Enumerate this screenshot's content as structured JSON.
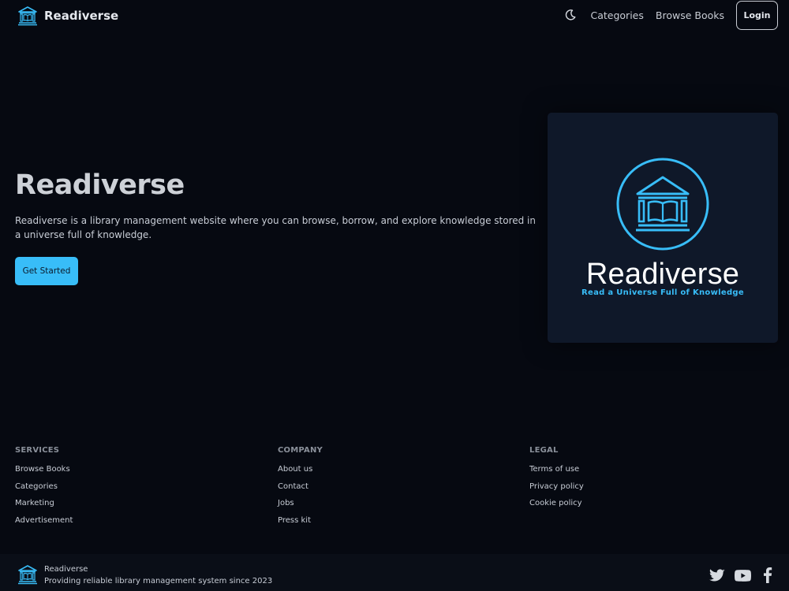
{
  "navbar": {
    "brand": "Readiverse",
    "links": [
      "Categories",
      "Browse Books"
    ],
    "login_label": "Login",
    "theme_icon": "moon-icon"
  },
  "hero": {
    "title": "Readiverse",
    "description": "Readiverse is a library management website where you can browse, borrow, and explore knowledge stored in a universe full of knowledge.",
    "cta_label": "Get Started",
    "card_title": "Readiverse",
    "card_tagline": "Read a Universe Full of Knowledge"
  },
  "footer": {
    "columns": [
      {
        "heading": "SERVICES",
        "links": [
          "Browse Books",
          "Categories",
          "Marketing",
          "Advertisement"
        ]
      },
      {
        "heading": "COMPANY",
        "links": [
          "About us",
          "Contact",
          "Jobs",
          "Press kit"
        ]
      },
      {
        "heading": "LEGAL",
        "links": [
          "Terms of use",
          "Privacy policy",
          "Cookie policy"
        ]
      }
    ],
    "bottom": {
      "name": "Readiverse",
      "tagline": "Providing reliable library management system since 2023"
    },
    "socials": [
      "twitter-icon",
      "youtube-icon",
      "facebook-icon"
    ]
  },
  "colors": {
    "background": "#060911",
    "accent": "#38bdf8",
    "card": "#0f1829"
  }
}
